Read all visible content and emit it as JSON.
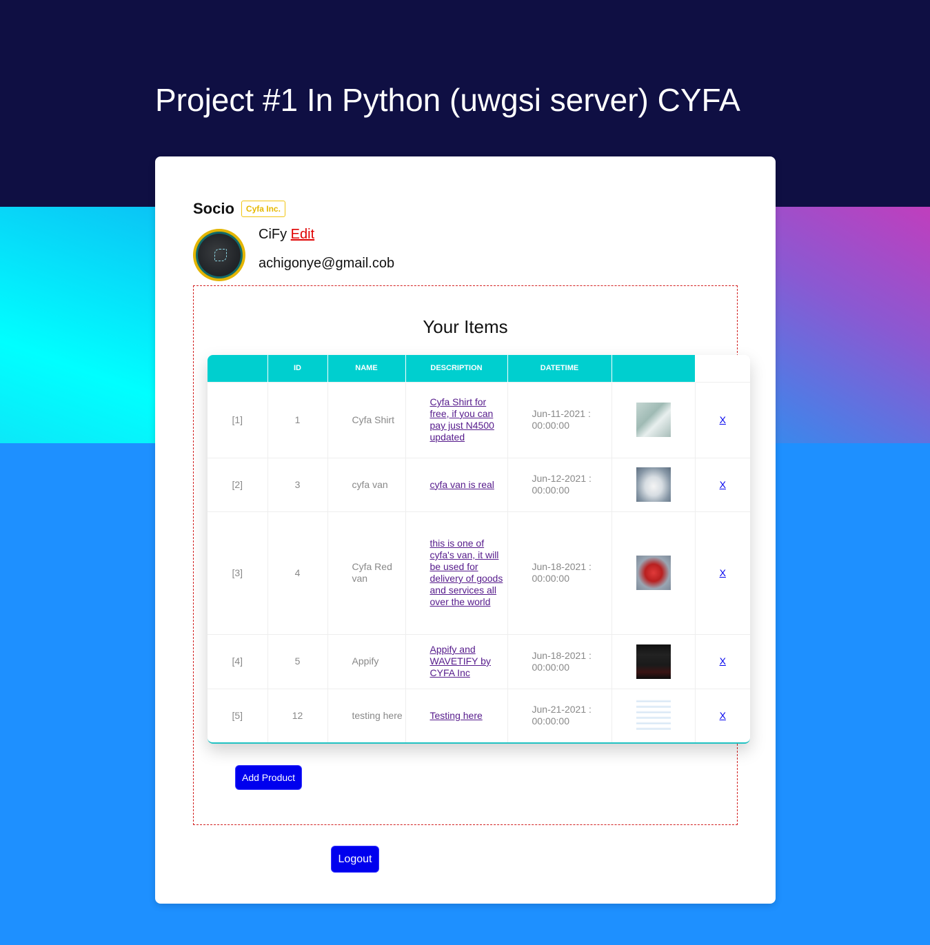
{
  "page_title": "Project #1 In Python (uwgsi server) CYFA",
  "brand": {
    "name": "Socio",
    "badge": "Cyfa Inc."
  },
  "user": {
    "name": "CiFy",
    "edit_label": "Edit",
    "email": "achigonye@gmail.cob"
  },
  "items": {
    "title": "Your Items",
    "columns": [
      "",
      "ID",
      "NAME",
      "DESCRIPTION",
      "DATETIME",
      "",
      ""
    ],
    "rows": [
      {
        "index": "[1]",
        "id": "1",
        "name": "Cyfa Shirt",
        "description": "Cyfa Shirt for free, if you can pay just N4500 updated",
        "datetime": "Jun-11-2021 : 00:00:00",
        "image": "shirt-image",
        "delete": "X"
      },
      {
        "index": "[2]",
        "id": "3",
        "name": "cyfa van",
        "description": "cyfa van is real",
        "datetime": "Jun-12-2021 : 00:00:00",
        "image": "white-van-image",
        "delete": "X"
      },
      {
        "index": "[3]",
        "id": "4",
        "name": "Cyfa Red van",
        "description": "this is one of cyfa's van, it will be used for delivery of goods and services all over the world",
        "datetime": "Jun-18-2021 : 00:00:00",
        "image": "red-van-image",
        "delete": "X"
      },
      {
        "index": "[4]",
        "id": "5",
        "name": "Appify",
        "description": "Appify and WAVETIFY by CYFA Inc",
        "datetime": "Jun-18-2021 : 00:00:00",
        "image": "app-screenshot-image",
        "delete": "X"
      },
      {
        "index": "[5]",
        "id": "12",
        "name": "testing here",
        "description": "Testing here",
        "datetime": "Jun-21-2021 : 00:00:00",
        "image": "web-screenshot-image",
        "delete": "X"
      }
    ],
    "add_button": "Add Product"
  },
  "logout_button": "Logout",
  "colors": {
    "header_bg": "#0f0f43",
    "page_bg": "#1e90ff",
    "table_header": "#00cfcf",
    "button": "#0000ee",
    "badge": "#e6b800",
    "edit_link": "#e00000"
  }
}
